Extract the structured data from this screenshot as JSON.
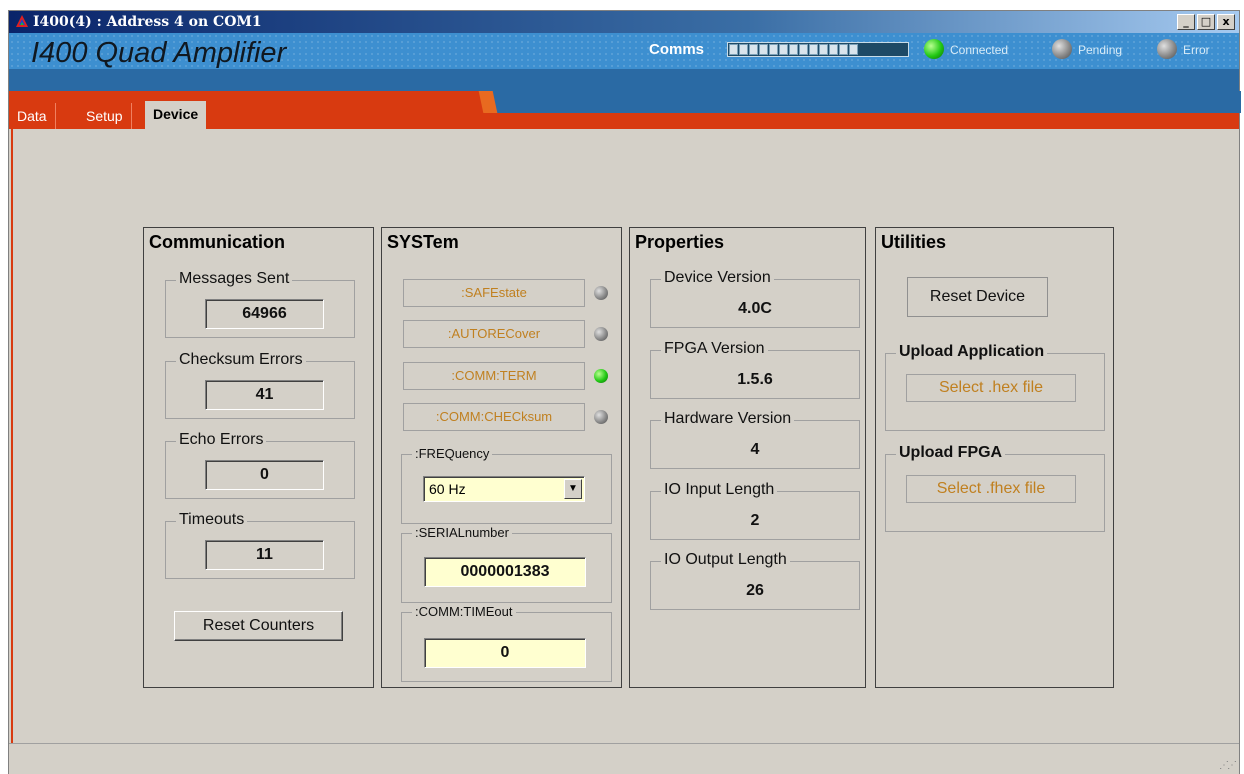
{
  "window": {
    "title": "I400(4) : Address 4 on COM1",
    "buttons": {
      "minimize": "_",
      "maximize": "□",
      "close": "x"
    }
  },
  "header": {
    "app_title": "I400 Quad Amplifier",
    "comms_label": "Comms",
    "comms_progress": 0.72,
    "indicators": [
      {
        "label": "Connected",
        "color": "green"
      },
      {
        "label": "Pending",
        "color": "grey"
      },
      {
        "label": "Error",
        "color": "grey"
      }
    ]
  },
  "tabs": [
    {
      "label": "Data",
      "active": false
    },
    {
      "label": "Setup",
      "active": false
    },
    {
      "label": "Device",
      "active": true
    }
  ],
  "communication": {
    "title": "Communication",
    "messages_sent": {
      "label": "Messages Sent",
      "value": "64966"
    },
    "checksum_errors": {
      "label": "Checksum Errors",
      "value": "41"
    },
    "echo_errors": {
      "label": "Echo Errors",
      "value": "0"
    },
    "timeouts": {
      "label": "Timeouts",
      "value": "11"
    },
    "reset_button": "Reset Counters"
  },
  "system": {
    "title": "SYSTem",
    "commands": [
      {
        "label": ":SAFEstate",
        "led": "grey"
      },
      {
        "label": ":AUTORECover",
        "led": "grey"
      },
      {
        "label": ":COMM:TERM",
        "led": "green"
      },
      {
        "label": ":COMM:CHECksum",
        "led": "grey"
      }
    ],
    "frequency": {
      "label": ":FREQuency",
      "value": "60 Hz"
    },
    "serial": {
      "label": ":SERIALnumber",
      "value": "0000001383"
    },
    "timeout": {
      "label": ":COMM:TIMEout",
      "value": "0"
    }
  },
  "properties": {
    "title": "Properties",
    "items": [
      {
        "label": "Device Version",
        "value": "4.0C"
      },
      {
        "label": "FPGA Version",
        "value": "1.5.6"
      },
      {
        "label": "Hardware Version",
        "value": "4"
      },
      {
        "label": "IO Input Length",
        "value": "2"
      },
      {
        "label": "IO Output Length",
        "value": "26"
      }
    ]
  },
  "utilities": {
    "title": "Utilities",
    "reset_device": "Reset Device",
    "upload_application": {
      "label": "Upload Application",
      "button": "Select .hex file"
    },
    "upload_fpga": {
      "label": "Upload FPGA",
      "button": "Select .fhex file"
    }
  },
  "colors": {
    "accent_red": "#d83a10",
    "header_blue": "#3d8fd0",
    "input_yellow": "#ffffd0",
    "disabled_text": "#c08020"
  }
}
